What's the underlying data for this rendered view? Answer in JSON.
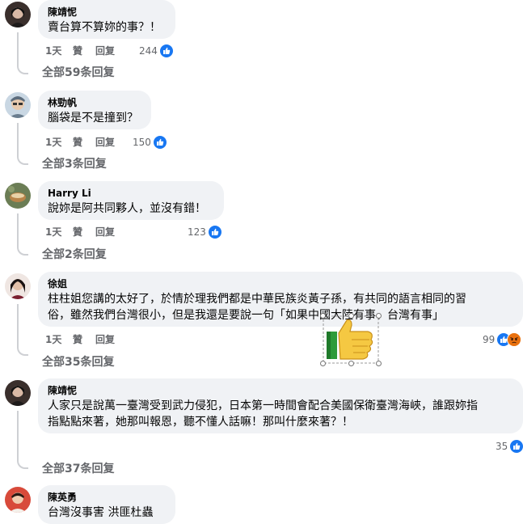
{
  "comments": [
    {
      "author": "陳靖怩",
      "text": "賣台算不算妳的事？！",
      "time": "1天",
      "like_label": "贊",
      "reply_label": "回复",
      "reactions": "244",
      "replies": "全部59条回复"
    },
    {
      "author": "林勁帆",
      "text": "腦袋是不是撞到？",
      "time": "1天",
      "like_label": "贊",
      "reply_label": "回复",
      "reactions": "150",
      "replies": "全部3条回复"
    },
    {
      "author": "Harry Li",
      "text": "說妳是阿共同夥人，並沒有錯！",
      "time": "1天",
      "like_label": "贊",
      "reply_label": "回复",
      "reactions": "123",
      "replies": "全部2条回复"
    },
    {
      "author": "徐姐",
      "text_line1": "柱柱姐您講的太好了，於情於理我們都是中華民族炎黃子孫，有共同的語言相同的習",
      "text_line2": "俗，雖然我們台灣很小，但是我還是要說一句「如果中國大陸有事、台灣有事」",
      "time": "1天",
      "like_label": "贊",
      "reply_label": "回复",
      "reactions": "99",
      "replies": "全部35条回复"
    },
    {
      "author": "陳靖怩",
      "text_line1": "人家只是說萬一臺灣受到武力侵犯，日本第一時間會配合美國保衛臺灣海峽，誰跟妳指",
      "text_line2": "指點點來著，她那叫報恩，聽不懂人話嘛！那叫什麼來著？！",
      "reactions": "35",
      "replies": "全部37条回复"
    },
    {
      "author": "陳英勇",
      "text": "台灣沒事害 洪匪杜蟲"
    }
  ],
  "colors": {
    "bubble": "#f0f2f5",
    "meta": "#65676b",
    "like_blue": "#1877f2",
    "thread_line": "#ced0d4"
  }
}
